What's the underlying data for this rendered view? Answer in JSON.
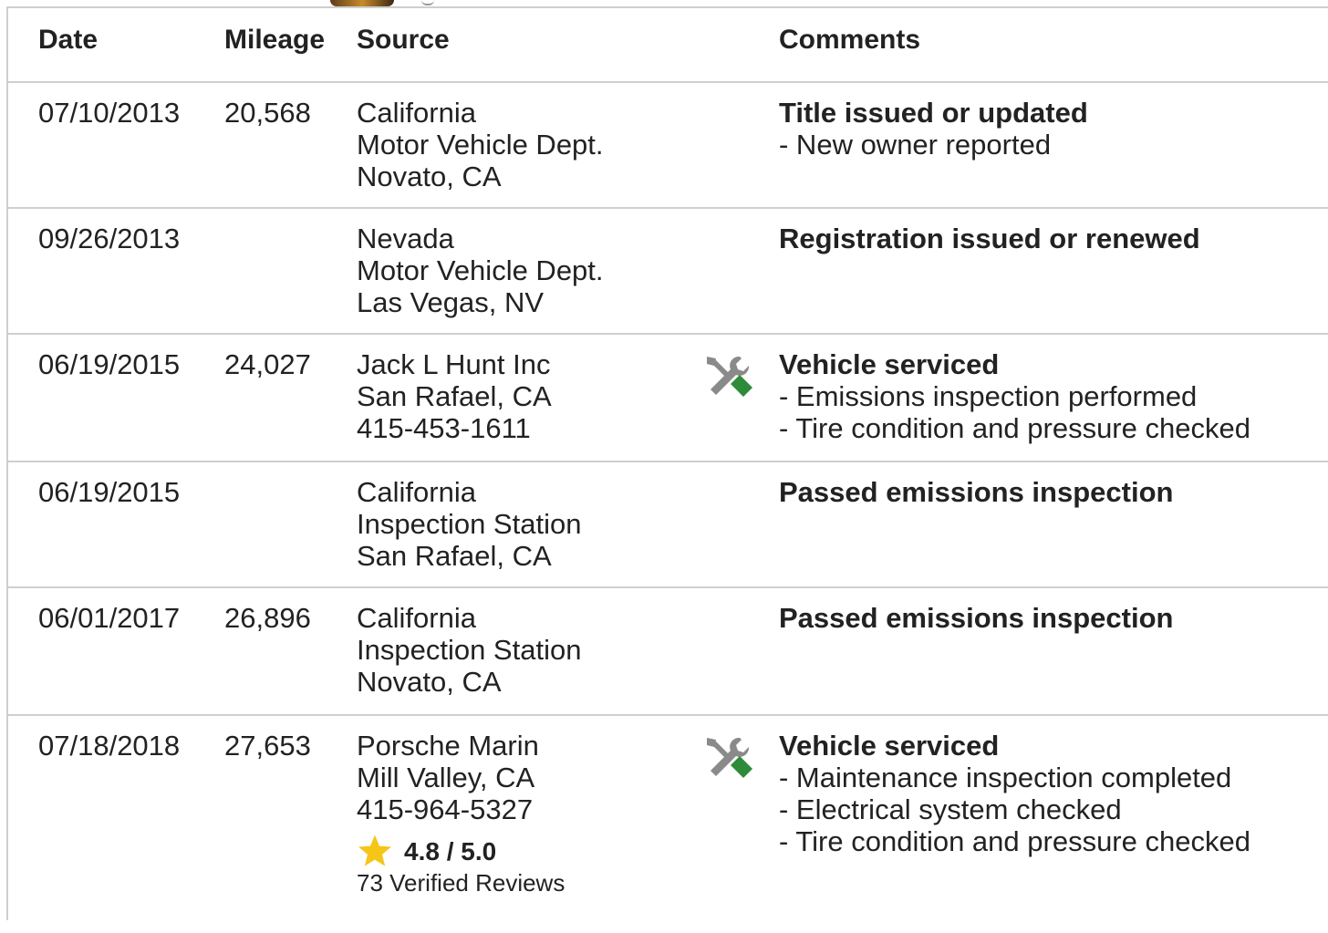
{
  "table": {
    "headers": {
      "date": "Date",
      "mileage": "Mileage",
      "source": "Source",
      "comments": "Comments"
    },
    "rows": [
      {
        "date": "07/10/2013",
        "mileage": "20,568",
        "source": [
          "California",
          "Motor Vehicle Dept.",
          "Novato, CA"
        ],
        "icon": null,
        "comment_title": "Title issued or updated",
        "comment_details": [
          "- New owner reported"
        ]
      },
      {
        "date": "09/26/2013",
        "mileage": "",
        "source": [
          "Nevada",
          "Motor Vehicle Dept.",
          "Las Vegas, NV"
        ],
        "icon": null,
        "comment_title": "Registration issued or renewed",
        "comment_details": []
      },
      {
        "date": "06/19/2015",
        "mileage": "24,027",
        "source": [
          "Jack L Hunt Inc",
          "San Rafael, CA",
          "415-453-1611"
        ],
        "icon": "service-tools-icon",
        "comment_title": "Vehicle serviced",
        "comment_details": [
          "- Emissions inspection performed",
          "- Tire condition and pressure checked"
        ]
      },
      {
        "date": "06/19/2015",
        "mileage": "",
        "source": [
          "California",
          "Inspection Station",
          "San Rafael, CA"
        ],
        "icon": null,
        "comment_title": "Passed emissions inspection",
        "comment_details": []
      },
      {
        "date": "06/01/2017",
        "mileage": "26,896",
        "source": [
          "California",
          "Inspection Station",
          "Novato, CA"
        ],
        "icon": null,
        "comment_title": "Passed emissions inspection",
        "comment_details": []
      },
      {
        "date": "07/18/2018",
        "mileage": "27,653",
        "source": [
          "Porsche Marin",
          "Mill Valley, CA",
          "415-964-5327"
        ],
        "rating": {
          "score": "4.8 / 5.0",
          "reviews": "73 Verified Reviews",
          "star_color": "#f5c518"
        },
        "icon": "service-tools-icon",
        "comment_title": "Vehicle serviced",
        "comment_details": [
          "- Maintenance inspection completed",
          "- Electrical system checked",
          "- Tire condition and pressure checked"
        ]
      }
    ]
  },
  "colors": {
    "border": "#cfcfcf",
    "text": "#222222",
    "icon_grey": "#8a8a8a",
    "icon_green": "#2e8b3a"
  }
}
